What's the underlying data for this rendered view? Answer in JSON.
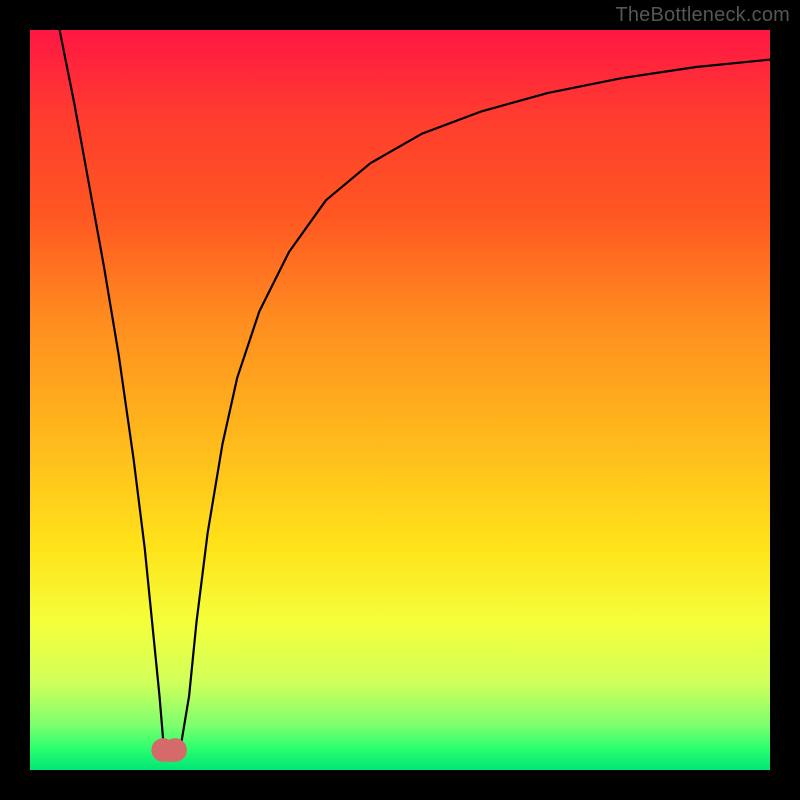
{
  "watermark": {
    "text": "TheBottleneck.com"
  },
  "chart_data": {
    "type": "line",
    "title": "",
    "xlabel": "",
    "ylabel": "",
    "xlim": [
      0,
      100
    ],
    "ylim": [
      0,
      100
    ],
    "grid": false,
    "legend": false,
    "series": [
      {
        "name": "curve",
        "comment": "Values are percent of plot height (100=top, 0=bottom). x is percent of plot width.",
        "x": [
          4,
          6,
          8,
          10,
          12,
          14,
          15.5,
          16.5,
          17.5,
          18,
          18.5,
          19.5,
          20.5,
          21.5,
          22.5,
          24,
          26,
          28,
          31,
          35,
          40,
          46,
          53,
          61,
          70,
          80,
          90,
          100
        ],
        "values": [
          100,
          90,
          79,
          68,
          56,
          42,
          30,
          20,
          10,
          4,
          2.5,
          2.5,
          4,
          10,
          20,
          32,
          44,
          53,
          62,
          70,
          77,
          82,
          86,
          89,
          91.5,
          93.5,
          95,
          96
        ]
      }
    ],
    "markers": [
      {
        "name": "trough-left",
        "x": 18.0,
        "y": 2.7,
        "r": 1.6,
        "color": "#d46a6a"
      },
      {
        "name": "trough-right",
        "x": 19.6,
        "y": 2.7,
        "r": 1.6,
        "color": "#d46a6a"
      }
    ],
    "colors": {
      "curve_stroke": "#000000",
      "marker_fill": "#d46a6a",
      "gradient_top": "#ff1744",
      "gradient_bottom": "#00e676"
    }
  }
}
